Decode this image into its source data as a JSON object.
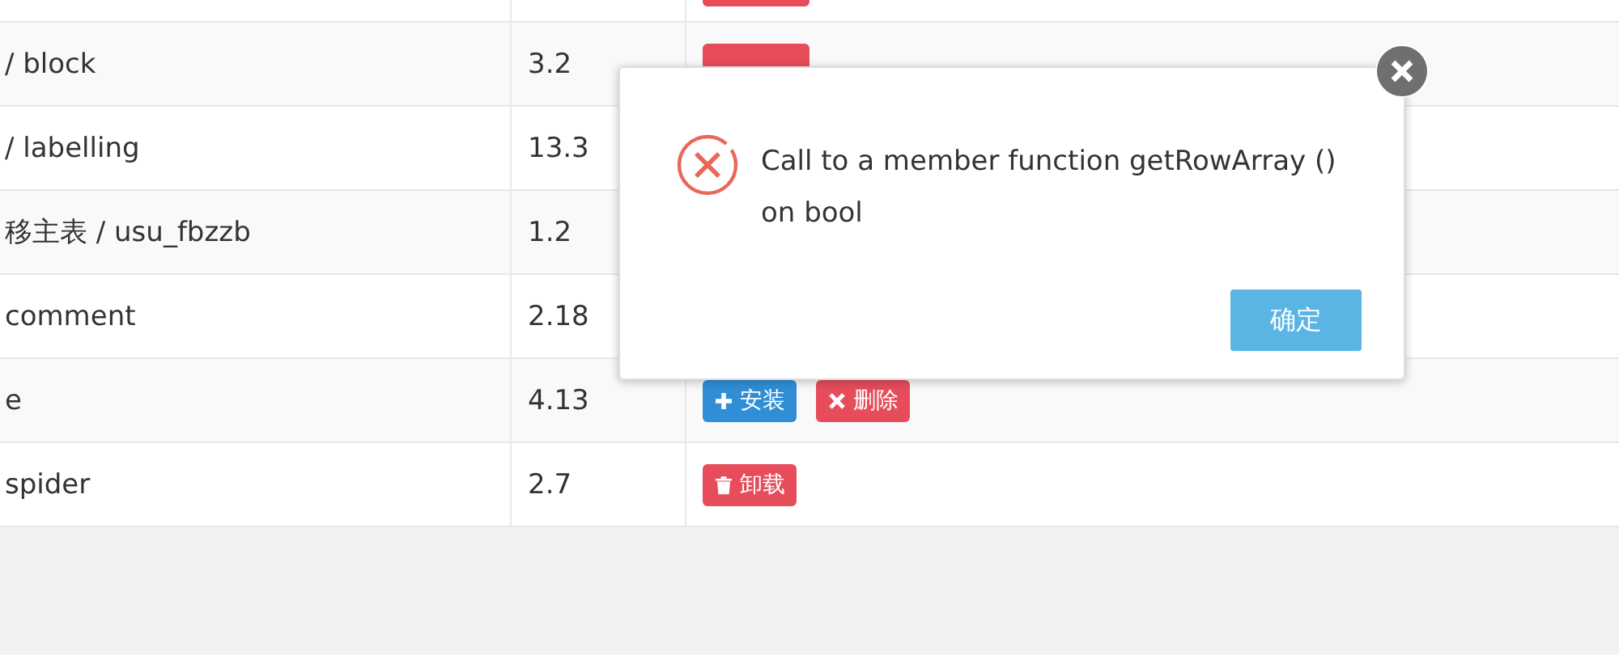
{
  "table": {
    "rows": [
      {
        "actions": [
          {
            "kind": "uninstall"
          }
        ]
      },
      {
        "name": "/ block",
        "version": "3.2",
        "actions": [
          {
            "kind": "uninstall"
          }
        ]
      },
      {
        "name": "/ labelling",
        "version": "13.3",
        "actions": []
      },
      {
        "name": "移主表 / usu_fbzzb",
        "version": "1.2",
        "actions": []
      },
      {
        "name": "comment",
        "version": "2.18",
        "actions": []
      },
      {
        "name": "e",
        "version": "4.13",
        "actions": [
          {
            "kind": "install",
            "label": "安装"
          },
          {
            "kind": "delete",
            "label": "删除"
          }
        ]
      },
      {
        "name": "spider",
        "version": "2.7",
        "actions": [
          {
            "kind": "uninstall",
            "label": "卸载"
          }
        ]
      }
    ]
  },
  "dialog": {
    "message": "Call to a member function getRowArray () on bool",
    "confirm": "确定"
  }
}
